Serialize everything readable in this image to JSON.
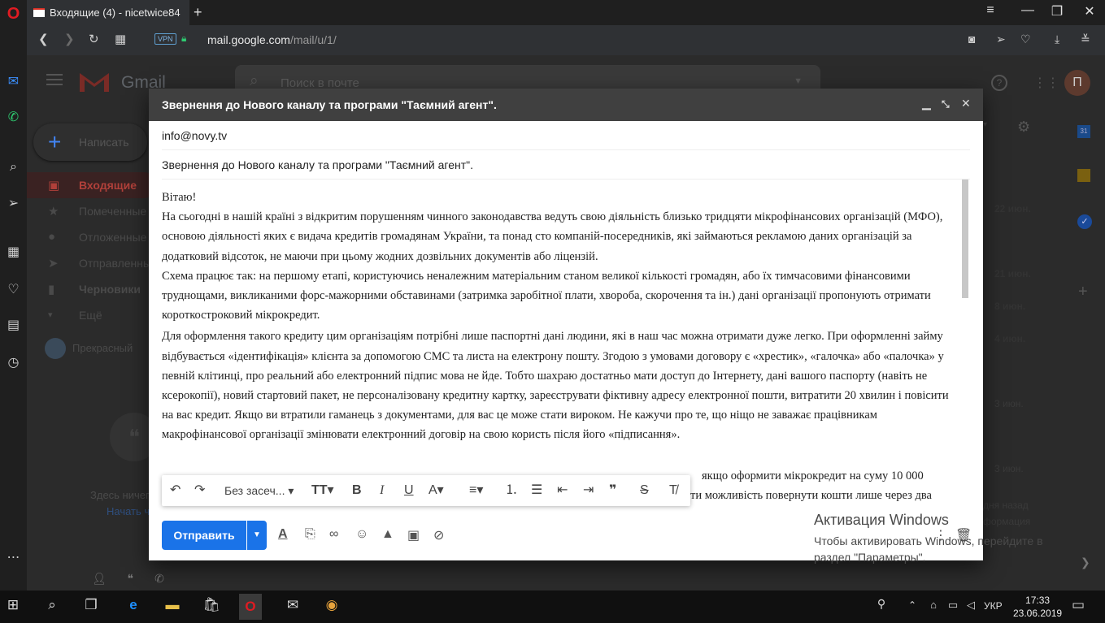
{
  "browser": {
    "tab_title": "Входящие (4) - nicetwice84",
    "vpn_badge": "VPN",
    "url_host": "mail.google.com",
    "url_path": "/mail/u/1/"
  },
  "gmail": {
    "logo_text": "Gmail",
    "search_placeholder": "Поиск в почте",
    "avatar_letter": "П",
    "compose_label": "Написать",
    "nav": [
      {
        "label": "Входящие",
        "icon": "inbox-icon"
      },
      {
        "label": "Помеченные",
        "icon": "star-icon"
      },
      {
        "label": "Отложенные",
        "icon": "clock-icon"
      },
      {
        "label": "Отправленные",
        "icon": "send-icon"
      },
      {
        "label": "Черновики",
        "icon": "draft-icon"
      },
      {
        "label": "Ещё",
        "icon": "chevron-down-icon"
      }
    ],
    "user_name": "Прекрасный",
    "hangouts_empty": "Здесь ничег",
    "hangouts_link": "Начать ч",
    "dates": [
      "22 июн.",
      "21 июн.",
      "8 июн.",
      "4 июн.",
      "3 июн.",
      "3 июн."
    ],
    "right_frag1": "дня назад",
    "right_frag2": "формация"
  },
  "activation": {
    "title": "Активация Windows",
    "text": "Чтобы активировать Windows, перейдите в раздел \"Параметры\"."
  },
  "compose": {
    "title": "Звернення до Нового каналу та програми \"Таємний агент\".",
    "to": "info@novy.tv",
    "subject": "Звернення до Нового каналу та програми \"Таємний агент\".",
    "body": [
      "Вітаю!",
      " На сьогодні в нашій країні з відкритим порушенням чинного законодавства ведуть свою діяльність близько тридцяти мікрофінансових організацій (МФО), основою діяльності яких є видача кредитів громадянам України, та понад сто компаній-посередників, які займаються рекламою даних організацій за додатковий відсоток, не маючи при цьому жодних дозвільних документів або ліцензій.",
      "Схема працює так: на першому етапі, користуючись неналежним матеріальним станом великої кількості громадян, або їх тимчасовими фінансовими труднощами, викликаними форс-мажорними обставинами (затримка заробітної плати, хвороба, скорочення та ін.) дані організації пропонують отримати короткостроковий мікрокредит.",
      "Для оформлення такого кредиту цим організаціям потрібні лише паспортні дані людини, які в наш час можна отримати дуже легко. При оформленні займу відбувається «ідентифікація» клієнта за допомогою СМС та листа на електрону пошту. Згодою з умовами договору є «хрестик», «галочка» або «палочка» у певній клітинці, про реальний або електронний підпис мова не йде. Тобто шахраю достатньо мати доступ до Інтернету, дані вашого паспорту (навіть не ксерокопії), новий стартовий пакет, не персоналізовану кредитну картку, зареєструвати фіктивну адресу електронної пошти, витратити 20 хвилин і повісити на вас кредит. Якщо ви втратили гаманець з документами, для вас це може стати вироком. Не кажучи про те, що ніщо не заважає працівникам макрофінансової організації змінювати електронний договір на свою користь після його «підписання»."
    ],
    "body_partial_right1": "якщо оформити мікрокредит на суму 10 000",
    "body_partial_right2": "ти можливість повернути кошти лише через два",
    "font_select": "Без засеч...",
    "send_label": "Отправить"
  },
  "taskbar": {
    "lang": "УКР",
    "time": "17:33",
    "date": "23.06.2019"
  }
}
